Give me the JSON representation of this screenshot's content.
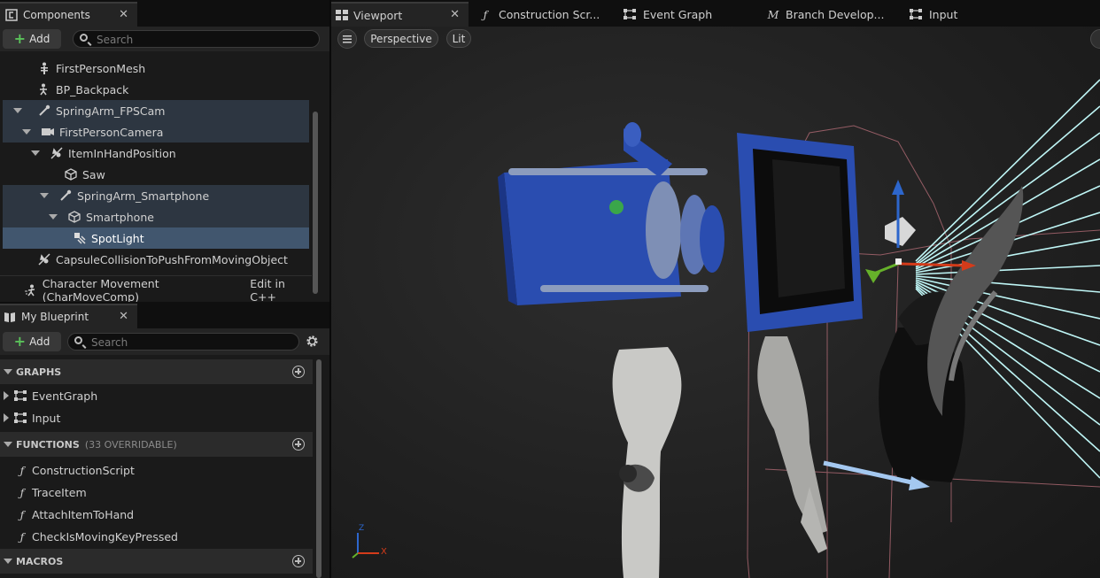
{
  "components_panel": {
    "tab_title": "Components",
    "add_label": "Add",
    "search_placeholder": "Search",
    "items": [
      {
        "label": "FirstPersonMesh",
        "icon": "skeleton-icon"
      },
      {
        "label": "BP_Backpack",
        "icon": "actor-icon"
      },
      {
        "label": "SpringArm_FPSCam",
        "icon": "spring-arm-icon"
      },
      {
        "label": "FirstPersonCamera",
        "icon": "camera-icon"
      },
      {
        "label": "ItemInHandPosition",
        "icon": "scene-icon"
      },
      {
        "label": "Saw",
        "icon": "static-mesh-icon"
      },
      {
        "label": "SpringArm_Smartphone",
        "icon": "spring-arm-icon"
      },
      {
        "label": "Smartphone",
        "icon": "static-mesh-icon"
      },
      {
        "label": "SpotLight",
        "icon": "spotlight-icon"
      },
      {
        "label": "CapsuleCollisionToPushFromMovingObject",
        "icon": "scene-icon"
      }
    ],
    "movement_component": {
      "label": "Character Movement (CharMoveComp)",
      "edit_link": "Edit in C++"
    }
  },
  "blueprint_panel": {
    "tab_title": "My Blueprint",
    "add_label": "Add",
    "search_placeholder": "Search",
    "sections": {
      "graphs": {
        "title": "GRAPHS",
        "items": [
          "EventGraph",
          "Input"
        ]
      },
      "functions": {
        "title": "FUNCTIONS",
        "subtitle": "(33 OVERRIDABLE)",
        "items": [
          "ConstructionScript",
          "TraceItem",
          "AttachItemToHand",
          "CheckIsMovingKeyPressed"
        ]
      },
      "macros": {
        "title": "MACROS"
      }
    }
  },
  "editor_tabs": [
    {
      "label": "Viewport",
      "icon": "viewport-icon",
      "active": true
    },
    {
      "label": "Construction Scr...",
      "icon": "function-icon"
    },
    {
      "label": "Event Graph",
      "icon": "graph-icon"
    },
    {
      "label": "Branch Develop...",
      "icon": "macro-icon"
    },
    {
      "label": "Input",
      "icon": "graph-icon"
    }
  ],
  "viewport": {
    "perspective_label": "Perspective",
    "lit_label": "Lit",
    "axis": {
      "x": "X",
      "z": "Z"
    }
  }
}
